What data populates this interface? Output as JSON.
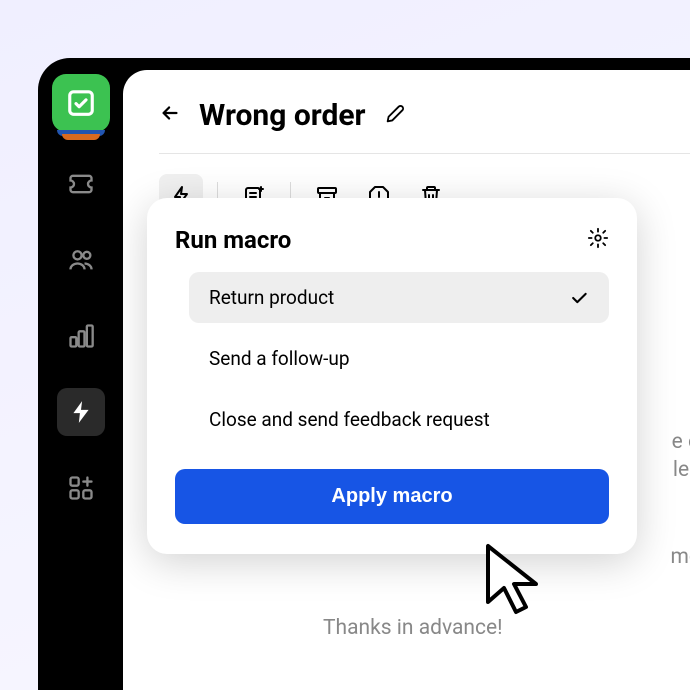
{
  "header": {
    "title": "Wrong order"
  },
  "macro": {
    "title": "Run macro",
    "options": [
      {
        "label": "Return product",
        "selected": true
      },
      {
        "label": "Send a follow-up",
        "selected": false
      },
      {
        "label": "Close and send feedback request",
        "selected": false
      }
    ],
    "apply_label": "Apply macro"
  },
  "bg": {
    "line1": "e o",
    "line2": "les",
    "line3": "me",
    "line4": "Thanks in advance!"
  }
}
